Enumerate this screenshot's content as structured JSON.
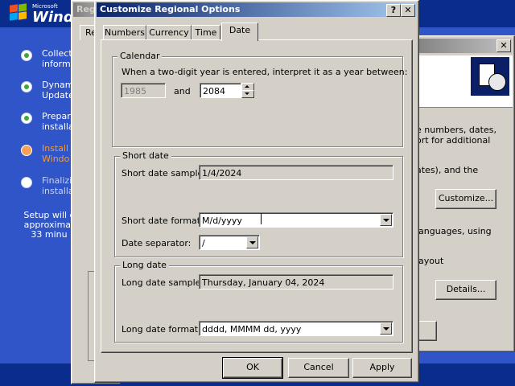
{
  "setup": {
    "logo_small": "Microsoft",
    "logo_big": "Windo",
    "steps": [
      {
        "label": "Collect\ninform",
        "state": "done"
      },
      {
        "label": "Dynam\nUpdate",
        "state": "done"
      },
      {
        "label": "Prepar\ninstalla",
        "state": "done"
      },
      {
        "label": "Install\nWindo",
        "state": "active"
      },
      {
        "label": "Finalizi\ninstalla",
        "state": "pending"
      }
    ],
    "time_text": "Setup will c\napproximat\n33 minu"
  },
  "behind_dialog": {
    "title_fragment": "Regi",
    "tab_fragment": "Re"
  },
  "regional_dialog": {
    "close_glyph": "✕",
    "text_line1": "e numbers, dates,",
    "text_line2": "ort for additional",
    "text_line3": "ates), and the",
    "customize_label": "Customize...",
    "text_line4": "languages, using",
    "text_line5": "layout",
    "details_label": "Details..."
  },
  "dialog": {
    "title": "Customize Regional Options",
    "help_glyph": "?",
    "close_glyph": "✕",
    "tabs": [
      "Numbers",
      "Currency",
      "Time",
      "Date"
    ],
    "selected_tab": "Date",
    "calendar": {
      "group_label": "Calendar",
      "instruction": "When a two-digit year is entered, interpret it as a year between:",
      "year_from": "1985",
      "and_label": "and",
      "year_to": "2084"
    },
    "short_date": {
      "group_label": "Short date",
      "sample_label": "Short date sample:",
      "sample_value": "1/4/2024",
      "format_label": "Short date format:",
      "format_value": "M/d/yyyy",
      "separator_label": "Date separator:",
      "separator_value": "/"
    },
    "long_date": {
      "group_label": "Long date",
      "sample_label": "Long date sample:",
      "sample_value": "Thursday, January 04, 2024",
      "format_label": "Long date format:",
      "format_value": "dddd, MMMM dd, yyyy"
    },
    "buttons": {
      "ok": "OK",
      "cancel": "Cancel",
      "apply": "Apply"
    }
  }
}
